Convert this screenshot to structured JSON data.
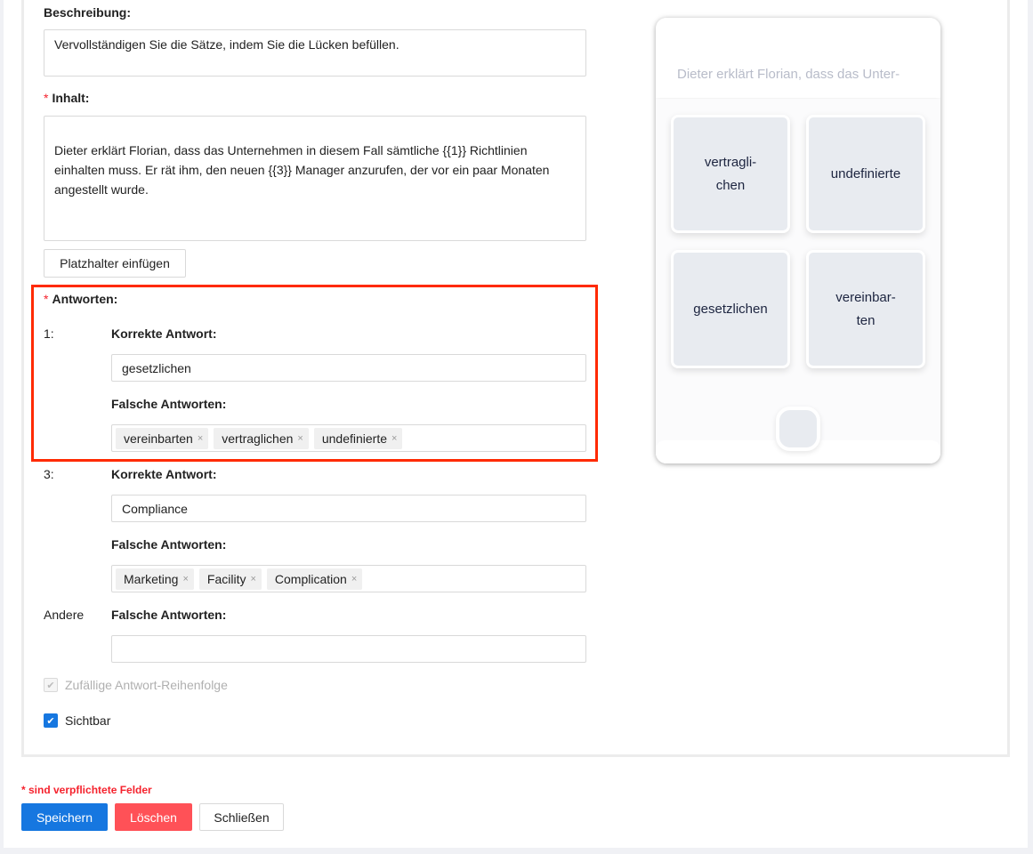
{
  "form": {
    "description_label": "Beschreibung",
    "description_value": "Vervollständigen Sie die Sätze, indem Sie die Lücken befüllen.",
    "content_label": "Inhalt",
    "content_value": "Dieter erklärt Florian, dass das Unternehmen in diesem Fall sämtliche {{1}} Richtlinien einhalten muss. Er rät ihm, den neuen {{3}} Manager anzurufen, der vor ein paar Monaten angestellt wurde.",
    "insert_placeholder_label": "Platzhalter einfügen",
    "answers_label": "Antworten",
    "answers": [
      {
        "index": "1:",
        "correct_label": "Korrekte Antwort",
        "correct_value": "gesetzlichen",
        "wrong_label": "Falsche Antworten",
        "wrong": [
          "vereinbarten",
          "vertraglichen",
          "undefinierte"
        ]
      },
      {
        "index": "3:",
        "correct_label": "Korrekte Antwort",
        "correct_value": "Compliance",
        "wrong_label": "Falsche Antworten",
        "wrong": [
          "Marketing",
          "Facility",
          "Complication"
        ]
      }
    ],
    "other_label": "Andere",
    "other_wrong_label": "Falsche Antworten",
    "other_wrong_value": "",
    "random_order_label": "Zufällige Antwort-Reihenfolge",
    "random_order_checked": true,
    "random_order_disabled": true,
    "visible_label": "Sichtbar",
    "visible_checked": true,
    "required_note": "* sind verpflichtete Felder",
    "save_label": "Speichern",
    "delete_label": "Löschen",
    "close_label": "Schließen",
    "remove_glyph": "×",
    "asterisk": "*",
    "colon": ":"
  },
  "preview": {
    "sentence": "Dieter erklärt Florian, dass das Unter-",
    "options": [
      "vertragli-\nchen",
      "undefinierte",
      "gesetzlichen",
      "vereinbar-\nten"
    ]
  },
  "colors": {
    "primary": "#1677e0",
    "danger": "#ff5157",
    "highlight": "#ff2a00",
    "required": "#f5222d"
  }
}
